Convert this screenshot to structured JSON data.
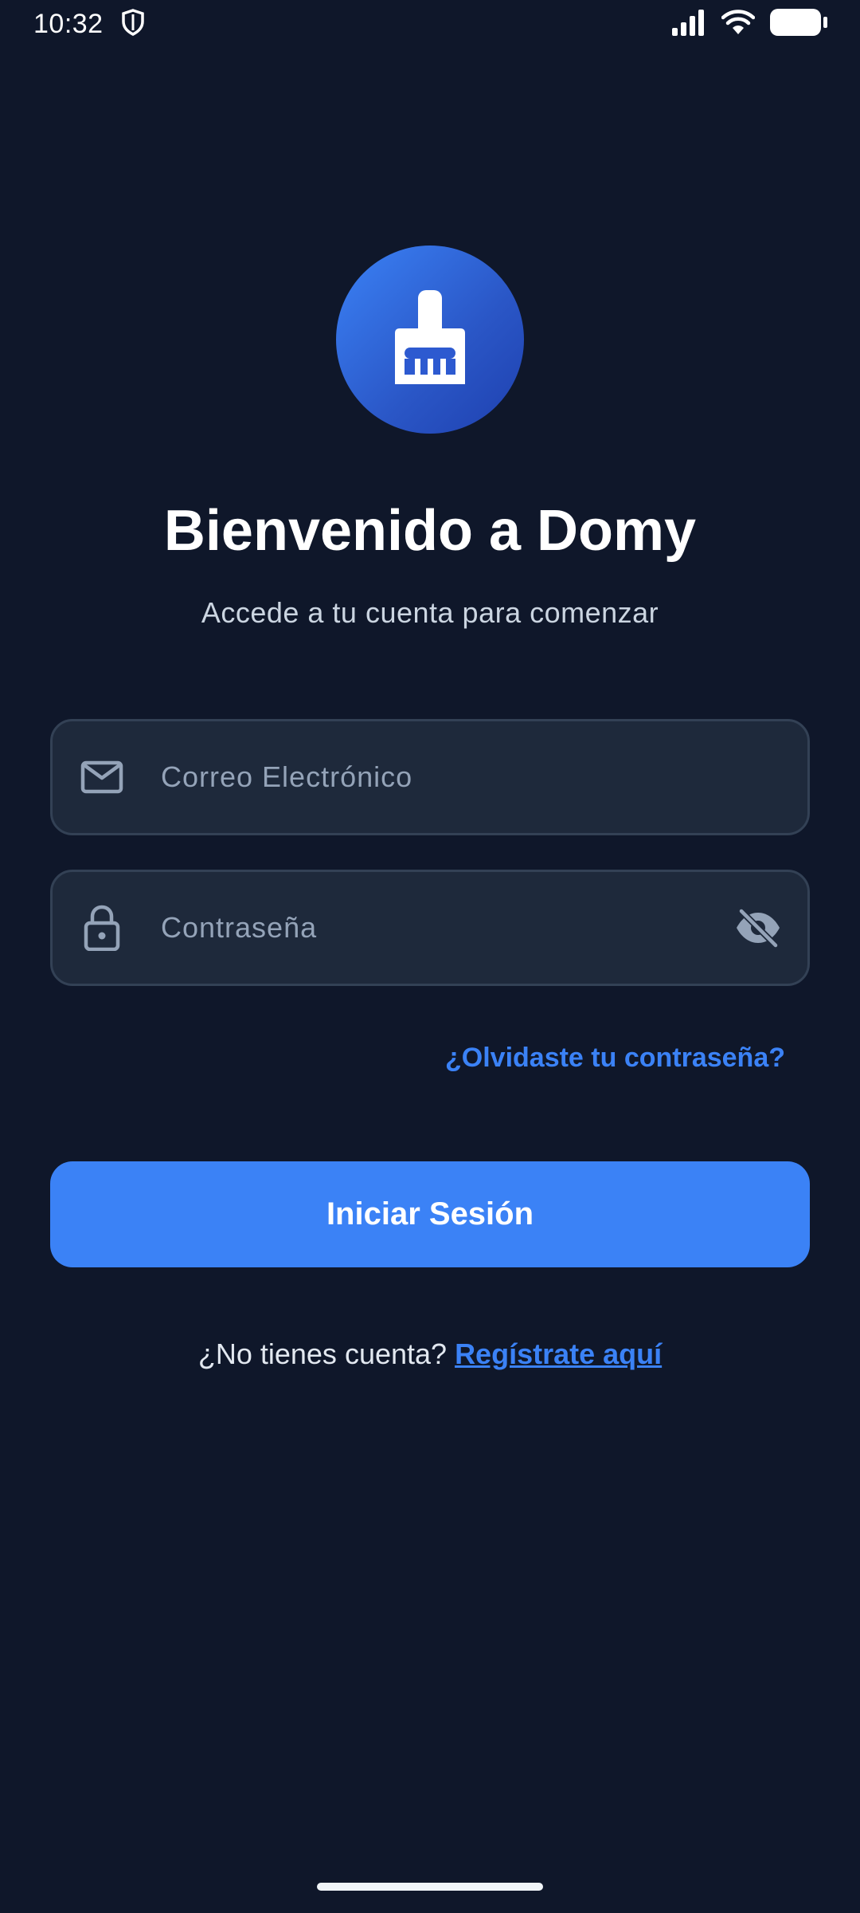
{
  "status_bar": {
    "time": "10:32",
    "icons": [
      "shield-icon",
      "signal-icon",
      "wifi-icon",
      "battery-icon"
    ]
  },
  "logo": {
    "icon": "brush-icon",
    "gradient": [
      "#3b82f6",
      "#1e40af"
    ]
  },
  "header": {
    "title": "Bienvenido a Domy",
    "subtitle": "Accede a tu cuenta para comenzar"
  },
  "form": {
    "email": {
      "placeholder": "Correo Electrónico",
      "value": "",
      "icon": "mail-icon"
    },
    "password": {
      "placeholder": "Contraseña",
      "value": "",
      "icon": "lock-icon",
      "toggle_icon": "eye-off-icon"
    },
    "forgot_label": "¿Olvidaste tu contraseña?",
    "submit_label": "Iniciar Sesión"
  },
  "footer": {
    "prompt": "¿No tienes cuenta?",
    "register_label": "Regístrate aquí"
  },
  "colors": {
    "background": "#0f172a",
    "field_background": "#1e293b",
    "field_border": "#334155",
    "accent": "#3b82f6",
    "muted_text": "#94a3b8"
  }
}
